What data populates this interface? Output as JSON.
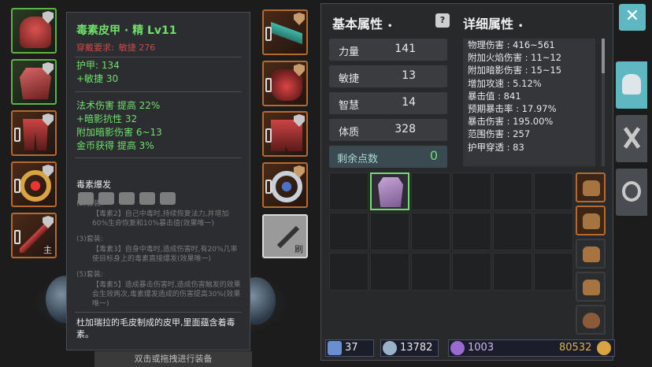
{
  "equipment_slots": {
    "left": [
      {
        "name": "helmet",
        "shield": "silver",
        "color": "#5fb24a"
      },
      {
        "name": "chest-armor",
        "shield": "silver",
        "color": "#5fb24a"
      },
      {
        "name": "leg-armor",
        "shield": "silver",
        "color": "#b46a2e"
      },
      {
        "name": "bracelet",
        "shield": "silver",
        "color": "#b46a2e"
      },
      {
        "name": "main-weapon",
        "shield": "silver",
        "color": "#b46a2e",
        "tag": "主"
      }
    ],
    "right": [
      {
        "name": "amulet",
        "shield": "bronze",
        "color": "#b46a2e"
      },
      {
        "name": "gloves",
        "shield": "bronze",
        "color": "#b46a2e"
      },
      {
        "name": "boots",
        "shield": "silver",
        "color": "#b46a2e"
      },
      {
        "name": "ring",
        "shield": "bronze",
        "color": "#b46a2e"
      }
    ]
  },
  "craft_button": {
    "label": "刷"
  },
  "tooltip": {
    "title": "毒素皮甲 · 精  Lv11",
    "req_label": "穿戴要求:",
    "req_value": "敏捷 276",
    "base_stats": [
      "护甲:  134",
      "+敏捷 30"
    ],
    "magic_stats": [
      "法术伤害 提高 22%",
      "+暗影抗性 32",
      "附加暗影伤害 6~13",
      "金币获得 提高 3%"
    ],
    "set_title": "毒素爆发",
    "set_bonuses": [
      {
        "title": "(2)套装:",
        "text": "【毒素2】自己中毒时,持续恢复法力,并增加60%生命恢复和10%暴击值(效果唯一)"
      },
      {
        "title": "(3)套装:",
        "text": "【毒素3】自身中毒时,造成伤害时,有20%几率使目标身上的毒素直接爆发(效果唯一)"
      },
      {
        "title": "(5)套装:",
        "text": "【毒素5】造成暴击伤害时,造成伤害触发的效果会生效两次,毒素爆发造成的伤害提高30%(效果唯一)"
      }
    ],
    "description": "杜加瑞拉的毛皮制成的皮甲,里面蕴含着毒素。"
  },
  "bottom_hint": "双击或拖拽进行装备",
  "basic_attrs": {
    "header": "基本属性",
    "rows": [
      {
        "label": "力量",
        "value": "141"
      },
      {
        "label": "敏捷",
        "value": "13"
      },
      {
        "label": "智慧",
        "value": "14"
      },
      {
        "label": "体质",
        "value": "328"
      }
    ],
    "points_label": "剩余点数",
    "points_value": "0"
  },
  "detail_attrs": {
    "header": "详细属性",
    "lines": [
      "物理伤害 : 416~561",
      "附加火焰伤害 : 11~12",
      "附加暗影伤害 : 15~15",
      "增加攻速 : 5.12%",
      "暴击值 : 841",
      "预期暴击率 : 17.97%",
      "暴击伤害 : 195.00%",
      "范围伤害 : 257",
      "护甲穿透 : 83"
    ]
  },
  "footer": {
    "level": "37",
    "gems": "13782",
    "crystals": "1003",
    "gold": "80532"
  },
  "colors": {
    "accent": "#5fb7c2",
    "green_text": "#6ee06a",
    "red_text": "#c94a4a",
    "orange_border": "#b46a2e"
  }
}
